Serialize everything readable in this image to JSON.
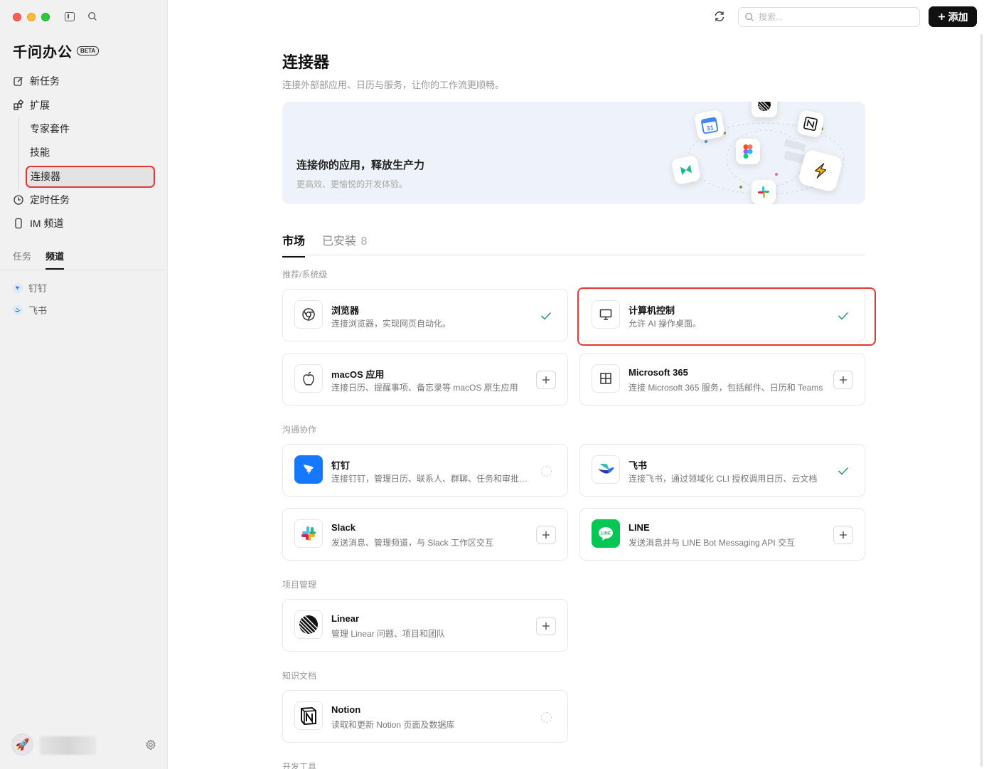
{
  "app": {
    "name": "千问办公",
    "badge": "BETA"
  },
  "sidebar": {
    "nav": [
      {
        "label": "新任务",
        "icon": "edit-icon"
      },
      {
        "label": "扩展",
        "icon": "extension-icon"
      },
      {
        "label": "定时任务",
        "icon": "clock-icon"
      },
      {
        "label": "IM 频道",
        "icon": "phone-icon"
      }
    ],
    "sub": [
      "专家套件",
      "技能",
      "连接器"
    ],
    "active_sub": "连接器",
    "tabs": [
      "任务",
      "频道"
    ],
    "active_tab": "频道",
    "channels": [
      {
        "label": "钉钉",
        "icon": "dingtalk-icon"
      },
      {
        "label": "飞书",
        "icon": "feishu-icon"
      }
    ]
  },
  "topbar": {
    "search_placeholder": "搜索...",
    "add_label": "添加"
  },
  "page": {
    "title": "连接器",
    "subtitle": "连接外部部应用、日历与服务，让你的工作流更顺畅。",
    "hero_title": "连接你的应用，释放生产力",
    "hero_subtitle": "更高效、更愉悦的开发体验。",
    "tabs": [
      {
        "label": "市场"
      },
      {
        "label": "已安装",
        "count": "8"
      }
    ],
    "sections": {
      "recommended": "推荐/系统级",
      "communication": "沟通协作",
      "project": "项目管理",
      "knowledge": "知识文档",
      "devtools": "开发工具"
    },
    "cards": {
      "browser": {
        "title": "浏览器",
        "desc": "连接浏览器，实现网页自动化。",
        "status": "installed"
      },
      "computer": {
        "title": "计算机控制",
        "desc": "允许 AI 操作桌面。",
        "status": "installed"
      },
      "macos": {
        "title": "macOS 应用",
        "desc": "连接日历、提醒事项、备忘录等 macOS 原生应用",
        "status": "add"
      },
      "ms365": {
        "title": "Microsoft 365",
        "desc": "连接 Microsoft 365 服务，包括邮件、日历和 Teams",
        "status": "add"
      },
      "dingtalk": {
        "title": "钉钉",
        "desc": "连接钉钉，管理日历、联系人、群聊、任务和审批流程",
        "status": "pending"
      },
      "feishu": {
        "title": "飞书",
        "desc": "连接飞书，通过领域化 CLI 授权调用日历、云文档",
        "status": "installed"
      },
      "slack": {
        "title": "Slack",
        "desc": "发送消息、管理频道，与 Slack 工作区交互",
        "status": "add"
      },
      "line": {
        "title": "LINE",
        "desc": "发送消息并与 LINE Bot Messaging API 交互",
        "status": "add"
      },
      "linear": {
        "title": "Linear",
        "desc": "管理 Linear 问题、项目和团队",
        "status": "add"
      },
      "notion": {
        "title": "Notion",
        "desc": "读取和更新 Notion 页面及数据库",
        "status": "pending"
      }
    }
  },
  "colors": {
    "accent_check": "#2e9e6b",
    "highlight": "#e53935",
    "dingtalk": "#1677ff",
    "line": "#06c755"
  }
}
